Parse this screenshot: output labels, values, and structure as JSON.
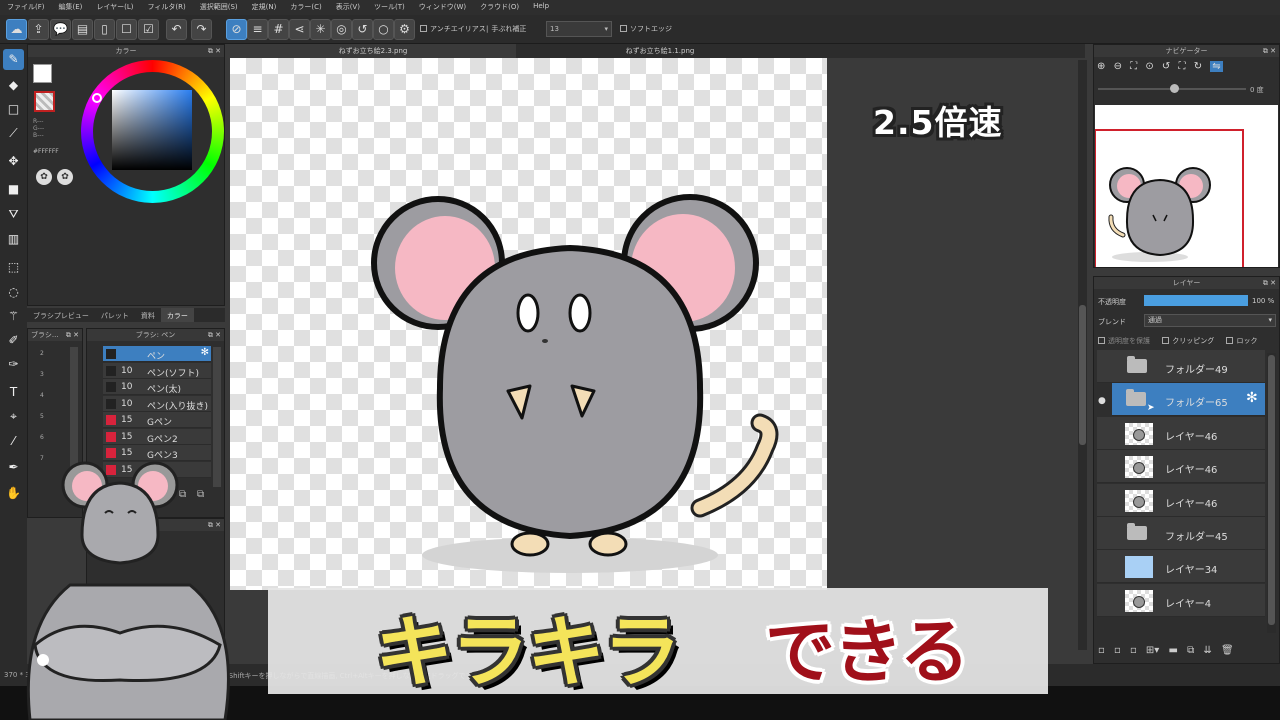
{
  "menu": [
    "ファイル(F)",
    "編集(E)",
    "レイヤー(L)",
    "フィルタ(R)",
    "選択範囲(S)",
    "定規(N)",
    "カラー(C)",
    "表示(V)",
    "ツール(T)",
    "ウィンドウ(W)",
    "クラウド(O)",
    "Help"
  ],
  "toolbar": {
    "antialias_label": "アンチエイリアス",
    "stabilizer_label": "手ぶれ補正",
    "stabilizer_value": "13",
    "soft_edge_label": "ソフトエッジ"
  },
  "color_panel": {
    "title": "カラー",
    "hex": "#FFFFFF",
    "rgb_labels": [
      "R---",
      "G---",
      "B---"
    ],
    "primary_color": "#FFFFFF",
    "accent": "#3d7fc0"
  },
  "panel_tabs": [
    "ブラシプレビュー",
    "パレット",
    "資料",
    "カラー"
  ],
  "brush_panel": {
    "size_title": "ブラシ...",
    "list_title": "ブラシ: ペン",
    "sizes": [
      "2",
      "3",
      "4",
      "5",
      "6",
      "7"
    ],
    "brushes": [
      {
        "size": "",
        "name": "ペン",
        "color": "#222",
        "selected": true
      },
      {
        "size": "10",
        "name": "ペン(ソフト)",
        "color": "#222",
        "selected": false
      },
      {
        "size": "10",
        "name": "ペン(太)",
        "color": "#222",
        "selected": false
      },
      {
        "size": "10",
        "name": "ペン(入り抜き)",
        "color": "#222",
        "selected": false
      },
      {
        "size": "15",
        "name": "Gペン",
        "color": "#d8233c",
        "selected": false
      },
      {
        "size": "15",
        "name": "Gペン2",
        "color": "#d8233c",
        "selected": false
      },
      {
        "size": "15",
        "name": "Gペン3",
        "color": "#d8233c",
        "selected": false
      },
      {
        "size": "15",
        "name": "",
        "color": "#d8233c",
        "selected": false
      }
    ]
  },
  "tabs": [
    "ねずお立ち絵2.3.png",
    "ねずお立ち絵1.1.png"
  ],
  "status": {
    "size": "370 * 320 pixel",
    "hint": "( -125, 2... Shiftキーを押しながらで直線描画, Ctrl+Altキーを押しながら左ドラッグでブ..."
  },
  "navigator": {
    "title": "ナビゲーター",
    "angle": "0 度"
  },
  "layer_panel": {
    "title": "レイヤー",
    "opacity_label": "不透明度",
    "opacity_value": "100 %",
    "opacity_fraction": 1.0,
    "blend_label": "ブレンド",
    "blend_value": "通過",
    "protect_label": "透明度を保護",
    "clipping_label": "クリッピング",
    "lock_label": "ロック",
    "layers": [
      {
        "name": "フォルダー49",
        "type": "folder",
        "selected": false
      },
      {
        "name": "フォルダー65",
        "type": "folder",
        "selected": true
      },
      {
        "name": "レイヤー46",
        "type": "layer",
        "selected": false
      },
      {
        "name": "レイヤー46",
        "type": "layer",
        "selected": false
      },
      {
        "name": "レイヤー46",
        "type": "layer",
        "selected": false
      },
      {
        "name": "フォルダー45",
        "type": "folder",
        "selected": false
      },
      {
        "name": "レイヤー34",
        "type": "color",
        "selected": false
      },
      {
        "name": "レイヤー4",
        "type": "layer",
        "selected": false
      }
    ]
  },
  "overlay": {
    "speed": "2.5倍速",
    "caption_main": "キラキラ",
    "caption_tail": "できる"
  }
}
